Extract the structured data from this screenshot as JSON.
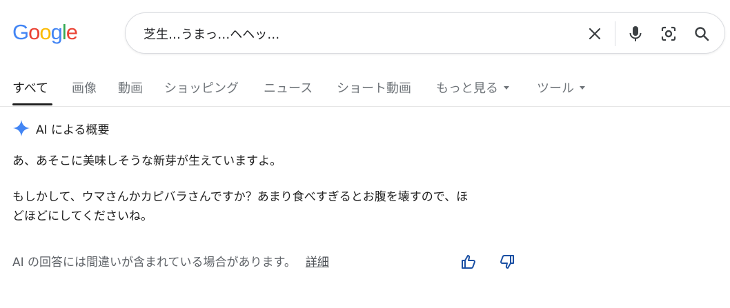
{
  "logo": {
    "letters": [
      "G",
      "o",
      "o",
      "g",
      "l",
      "e"
    ]
  },
  "search": {
    "query": "芝生…うまっ…ヘヘッ…"
  },
  "tabs": [
    {
      "label": "すべて"
    },
    {
      "label": "画像"
    },
    {
      "label": "動画"
    },
    {
      "label": "ショッピング"
    },
    {
      "label": "ニュース"
    },
    {
      "label": "ショート動画"
    },
    {
      "label": "もっと見る"
    },
    {
      "label": "ツール"
    }
  ],
  "ai_overview": {
    "title": "AI による概要",
    "paragraph1": "あ、あそこに美味しそうな新芽が生えていますよ。",
    "paragraph2_line1": "もしかして、ウマさんかカピバラさんですか？あまり食べすぎるとお腹を壊すので、ほ",
    "paragraph2_line2": "どほどにしてくださいね。",
    "disclaimer": "AI の回答には間違いが含まれている場合があります。",
    "details_link": "詳細"
  },
  "colors": {
    "accent_blue": "#4285f4",
    "logo_red": "#ea4335",
    "logo_yellow": "#fbbc05",
    "logo_green": "#34a853"
  },
  "icons": [
    "clear-icon",
    "mic-icon",
    "lens-icon",
    "search-icon",
    "sparkle-icon",
    "thumbs-up-icon",
    "thumbs-down-icon",
    "caret-down-icon"
  ]
}
